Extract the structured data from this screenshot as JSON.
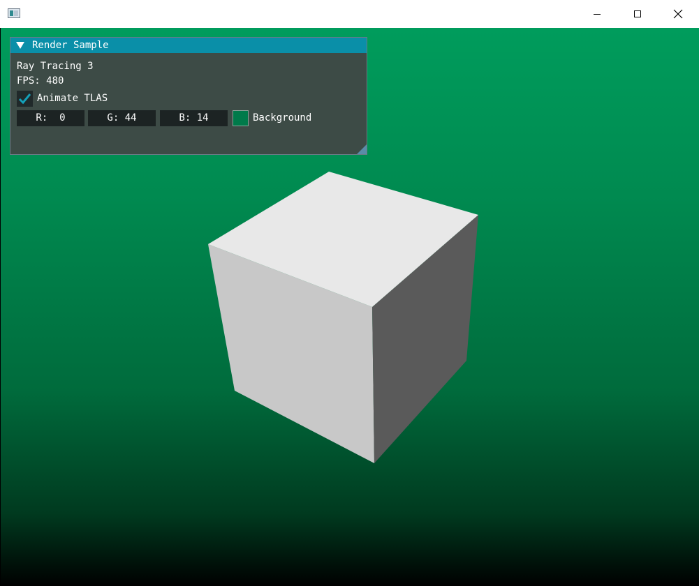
{
  "window": {
    "icon": "app-window-icon",
    "controls": {
      "minimize_icon": "minimize-icon",
      "maximize_icon": "maximize-icon",
      "close_icon": "close-icon"
    }
  },
  "scene": {
    "background_top": "#009c5c",
    "background_bottom": "#000000",
    "cube_top_color": "#e8e8e8",
    "cube_left_color": "#c8c8c8",
    "cube_right_color": "#5a5a5a"
  },
  "panel": {
    "title": "Render Sample",
    "collapse_icon": "collapse-triangle-icon",
    "sample_name": "Ray Tracing 3",
    "fps_label": "FPS: 480",
    "animate_tlas": {
      "label": "Animate TLAS",
      "checked": true,
      "check_icon": "checkmark-icon"
    },
    "background_color": {
      "r_label": "R:  0",
      "g_label": "G: 44",
      "b_label": "B: 14",
      "label": "Background",
      "swatch": "#007a4a"
    }
  }
}
